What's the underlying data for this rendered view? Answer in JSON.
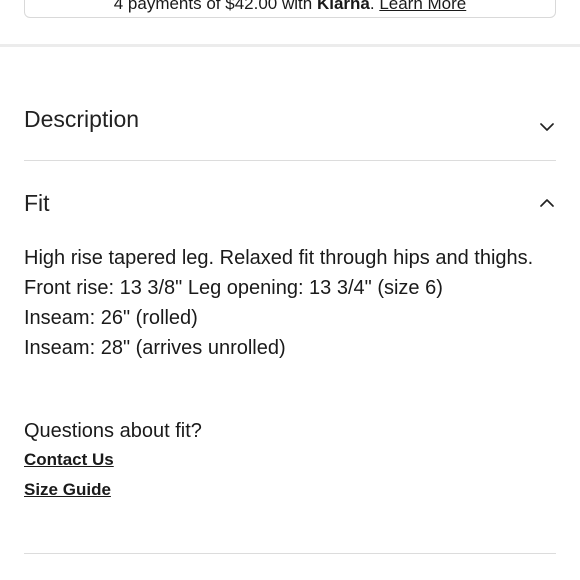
{
  "klarna": {
    "prefix": "4 payments of $42.00 with",
    "brand": "Klarna",
    "link": "Learn More"
  },
  "accordion": {
    "description": {
      "title": "Description",
      "icon": "chevron-down-icon",
      "expanded": false
    },
    "fit": {
      "title": "Fit",
      "icon": "chevron-up-icon",
      "expanded": true,
      "lines": [
        "High rise tapered leg. Relaxed fit through hips and thighs.",
        "Front rise: 13 3/8\" Leg opening: 13 3/4\" (size 6)",
        "Inseam: 26\" (rolled)",
        "Inseam: 28\" (arrives unrolled)"
      ],
      "questions": "Questions about fit?",
      "contact_link": "Contact Us",
      "size_guide_link": "Size Guide"
    }
  }
}
